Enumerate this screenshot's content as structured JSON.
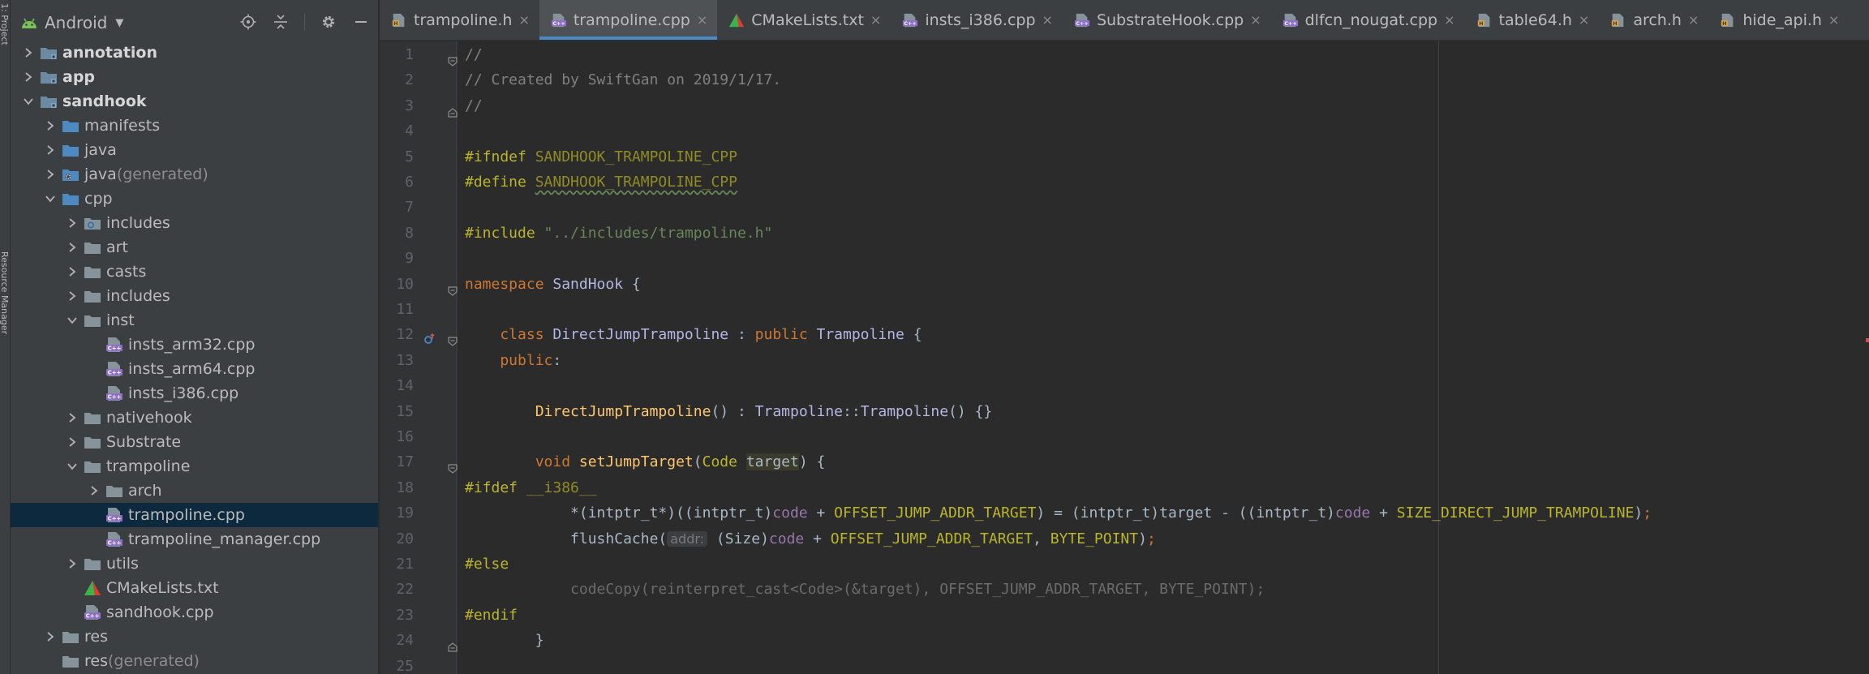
{
  "tool_strip": {
    "project_label": "1: Project",
    "resource_label": "Resource Manager"
  },
  "project_panel": {
    "title": "Android",
    "tree": [
      {
        "label": "annotation",
        "suffix": "",
        "depth": 0,
        "state": "collapsed",
        "icon": "module-folder-icon",
        "bold": true,
        "selected": false
      },
      {
        "label": "app",
        "suffix": "",
        "depth": 0,
        "state": "collapsed",
        "icon": "module-folder-icon",
        "bold": true,
        "selected": false
      },
      {
        "label": "sandhook",
        "suffix": "",
        "depth": 0,
        "state": "expanded",
        "icon": "module-folder-icon",
        "bold": true,
        "selected": false
      },
      {
        "label": "manifests",
        "suffix": "",
        "depth": 1,
        "state": "collapsed",
        "icon": "blue-folder-icon",
        "bold": false,
        "selected": false
      },
      {
        "label": "java",
        "suffix": "",
        "depth": 1,
        "state": "collapsed",
        "icon": "blue-folder-icon",
        "bold": false,
        "selected": false
      },
      {
        "label": "java",
        "suffix": " (generated)",
        "depth": 1,
        "state": "collapsed",
        "icon": "generated-folder-icon",
        "bold": false,
        "selected": false
      },
      {
        "label": "cpp",
        "suffix": "",
        "depth": 1,
        "state": "expanded",
        "icon": "blue-folder-icon",
        "bold": false,
        "selected": false
      },
      {
        "label": "includes",
        "suffix": "",
        "depth": 2,
        "state": "collapsed",
        "icon": "include-folder-icon",
        "bold": false,
        "selected": false
      },
      {
        "label": "art",
        "suffix": "",
        "depth": 2,
        "state": "collapsed",
        "icon": "folder-icon",
        "bold": false,
        "selected": false
      },
      {
        "label": "casts",
        "suffix": "",
        "depth": 2,
        "state": "collapsed",
        "icon": "folder-icon",
        "bold": false,
        "selected": false
      },
      {
        "label": "includes",
        "suffix": "",
        "depth": 2,
        "state": "collapsed",
        "icon": "folder-icon",
        "bold": false,
        "selected": false
      },
      {
        "label": "inst",
        "suffix": "",
        "depth": 2,
        "state": "expanded",
        "icon": "folder-icon",
        "bold": false,
        "selected": false
      },
      {
        "label": "insts_arm32.cpp",
        "suffix": "",
        "depth": 3,
        "state": "leaf",
        "icon": "cpp-file-icon",
        "bold": false,
        "selected": false
      },
      {
        "label": "insts_arm64.cpp",
        "suffix": "",
        "depth": 3,
        "state": "leaf",
        "icon": "cpp-file-icon",
        "bold": false,
        "selected": false
      },
      {
        "label": "insts_i386.cpp",
        "suffix": "",
        "depth": 3,
        "state": "leaf",
        "icon": "cpp-file-icon",
        "bold": false,
        "selected": false
      },
      {
        "label": "nativehook",
        "suffix": "",
        "depth": 2,
        "state": "collapsed",
        "icon": "folder-icon",
        "bold": false,
        "selected": false
      },
      {
        "label": "Substrate",
        "suffix": "",
        "depth": 2,
        "state": "collapsed",
        "icon": "folder-icon",
        "bold": false,
        "selected": false
      },
      {
        "label": "trampoline",
        "suffix": "",
        "depth": 2,
        "state": "expanded",
        "icon": "folder-icon",
        "bold": false,
        "selected": false
      },
      {
        "label": "arch",
        "suffix": "",
        "depth": 3,
        "state": "collapsed",
        "icon": "folder-icon",
        "bold": false,
        "selected": false
      },
      {
        "label": "trampoline.cpp",
        "suffix": "",
        "depth": 3,
        "state": "leaf",
        "icon": "cpp-file-icon",
        "bold": false,
        "selected": true
      },
      {
        "label": "trampoline_manager.cpp",
        "suffix": "",
        "depth": 3,
        "state": "leaf",
        "icon": "cpp-file-icon",
        "bold": false,
        "selected": false
      },
      {
        "label": "utils",
        "suffix": "",
        "depth": 2,
        "state": "collapsed",
        "icon": "folder-icon",
        "bold": false,
        "selected": false
      },
      {
        "label": "CMakeLists.txt",
        "suffix": "",
        "depth": 2,
        "state": "leaf",
        "icon": "cmake-icon",
        "bold": false,
        "selected": false
      },
      {
        "label": "sandhook.cpp",
        "suffix": "",
        "depth": 2,
        "state": "leaf",
        "icon": "cpp-file-icon",
        "bold": false,
        "selected": false
      },
      {
        "label": "res",
        "suffix": "",
        "depth": 1,
        "state": "collapsed",
        "icon": "folder-icon",
        "bold": false,
        "selected": false
      },
      {
        "label": "res",
        "suffix": " (generated)",
        "depth": 1,
        "state": "leaf",
        "icon": "folder-icon",
        "bold": false,
        "selected": false
      }
    ]
  },
  "tabs": [
    {
      "label": "trampoline.h",
      "icon": "h-file-icon",
      "active": false
    },
    {
      "label": "trampoline.cpp",
      "icon": "cpp-file-icon",
      "active": true
    },
    {
      "label": "CMakeLists.txt",
      "icon": "cmake-icon",
      "active": false
    },
    {
      "label": "insts_i386.cpp",
      "icon": "cpp-file-icon",
      "active": false
    },
    {
      "label": "SubstrateHook.cpp",
      "icon": "cpp-file-icon",
      "active": false
    },
    {
      "label": "dlfcn_nougat.cpp",
      "icon": "cpp-file-icon",
      "active": false
    },
    {
      "label": "table64.h",
      "icon": "h-file-icon",
      "active": false
    },
    {
      "label": "arch.h",
      "icon": "h-file-icon",
      "active": false
    },
    {
      "label": "hide_api.h",
      "icon": "h-file-icon",
      "active": false
    }
  ],
  "tab_close_glyph": "×",
  "editor": {
    "line_numbers": [
      "1",
      "2",
      "3",
      "4",
      "5",
      "6",
      "7",
      "8",
      "9",
      "10",
      "11",
      "12",
      "13",
      "14",
      "15",
      "16",
      "17",
      "18",
      "19",
      "20",
      "21",
      "22",
      "23",
      "24",
      "25"
    ],
    "lines": {
      "l1": [
        "//"
      ],
      "l2": [
        "// Created by SwiftGan on 2019/1/17."
      ],
      "l3": [
        "//"
      ],
      "l5": [
        "#ifndef ",
        "SANDHOOK_TRAMPOLINE_CPP"
      ],
      "l6": [
        "#define ",
        "SANDHOOK_TRAMPOLINE_CPP"
      ],
      "l8": [
        "#include ",
        "\"../includes/trampoline.h\""
      ],
      "l10": [
        "namespace ",
        "SandHook",
        " {"
      ],
      "l12": [
        "    class ",
        "DirectJumpTrampoline",
        " : ",
        "public ",
        "Trampoline",
        " {"
      ],
      "l13": [
        "    public",
        ":"
      ],
      "l15": [
        "        ",
        "DirectJumpTrampoline",
        "() : ",
        "Trampoline",
        "::",
        "Trampoline",
        "() {}"
      ],
      "l17": [
        "        void ",
        "setJumpTarget",
        "(",
        "Code",
        " ",
        "target",
        ") {"
      ],
      "l18": [
        "#ifdef ",
        "__i386__"
      ],
      "l19": [
        "            *(intptr_t*)((intptr_t)",
        "code",
        " + ",
        "OFFSET_JUMP_ADDR_TARGET",
        ") = (intptr_t)target - ((intptr_t)",
        "code",
        " + ",
        "SIZE_DIRECT_JUMP_TRAMPOLINE",
        ")",
        ";"
      ],
      "l20": [
        "            flushCache(",
        "addr:",
        " (Size)",
        "code",
        " + ",
        "OFFSET_JUMP_ADDR_TARGET",
        ", ",
        "BYTE_POINT",
        ")",
        ";"
      ],
      "l21": [
        "#else"
      ],
      "l22": [
        "            codeCopy(reinterpret_cast<Code>(&target), OFFSET_JUMP_ADDR_TARGET, BYTE_POINT);"
      ],
      "l23": [
        "#endif"
      ],
      "l24": [
        "        }"
      ]
    }
  },
  "colors": {
    "accent": "#4a88c7",
    "keyword": "#cc7832",
    "macro": "#bbb529",
    "string": "#6a8759",
    "class": "#b5b6e3",
    "function": "#ffc66d",
    "member": "#9876aa",
    "comment": "#808080",
    "selection": "#0d293e"
  }
}
